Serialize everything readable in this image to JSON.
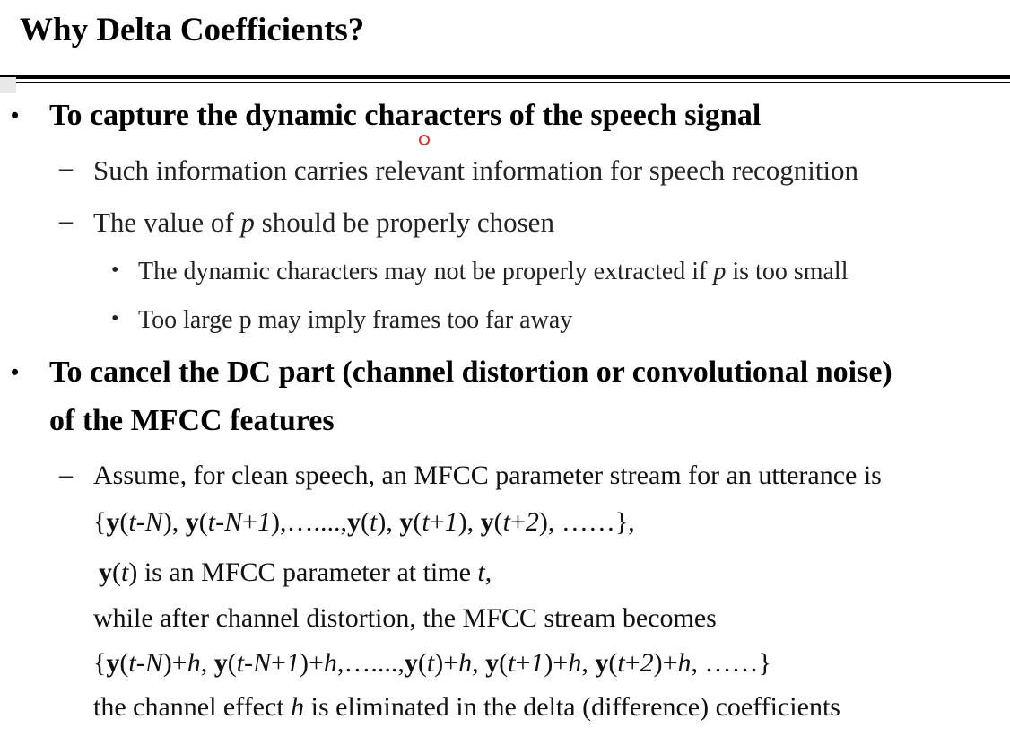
{
  "slide": {
    "title": "Why Delta Coefficients?",
    "bullets": {
      "b1": {
        "marker": "•",
        "text": "To capture the dynamic characters of the speech signal",
        "sub": {
          "s1": {
            "marker": "–",
            "text": "Such information carries relevant information for speech recognition"
          },
          "s2": {
            "marker": "–",
            "text_before": "The value of ",
            "var": "p",
            "text_after": " should be properly chosen",
            "sub": {
              "t1": {
                "marker": "•",
                "text_before": "The dynamic characters may not be properly extracted if ",
                "var": "p",
                "text_after": " is too small"
              },
              "t2": {
                "marker": "•",
                "text": "Too large p may imply frames too far away"
              }
            }
          }
        }
      },
      "b2": {
        "marker": "•",
        "text_line1": "To cancel the DC part (channel distortion or convolutional noise)",
        "text_line2": "of the MFCC features",
        "sub": {
          "s1": {
            "marker": "–",
            "lines": {
              "l1": "Assume, for clean speech, an MFCC parameter stream for an utterance is",
              "l2": "{y(t-N), y(t-N+1),…....,y(t), y(t+1), y(t+2), ……},",
              "l3": "y(t) is an MFCC parameter at time t,",
              "l4": "while after channel distortion, the MFCC stream becomes",
              "l5": "{y(t-N)+h, y(t-N+1)+h,…....,y(t)+h, y(t+1)+h, y(t+2)+h, ……}",
              "l6": "the channel effect h is eliminated in the delta (difference) coefficients"
            }
          }
        }
      }
    }
  }
}
